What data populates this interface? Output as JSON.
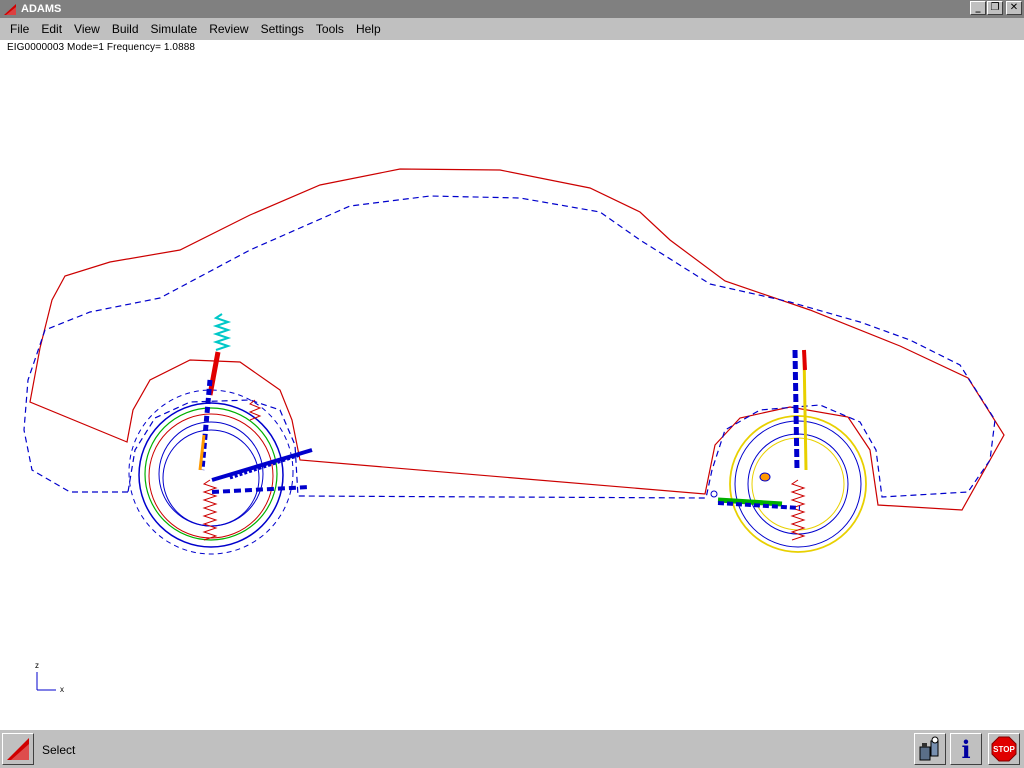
{
  "window": {
    "title": "ADAMS",
    "minimize": "_",
    "restore": "❐",
    "close": "✕"
  },
  "menu": [
    {
      "label": "File"
    },
    {
      "label": "Edit"
    },
    {
      "label": "View"
    },
    {
      "label": "Build"
    },
    {
      "label": "Simulate"
    },
    {
      "label": "Review"
    },
    {
      "label": "Settings"
    },
    {
      "label": "Tools"
    },
    {
      "label": "Help"
    }
  ],
  "viewport": {
    "info": "EIG0000003  Mode=1  Frequency= 1.0888",
    "triad": {
      "z_label": "z",
      "x_label": "x"
    }
  },
  "status": {
    "text": "Select",
    "tools": [
      {
        "name": "tools-palette-icon"
      },
      {
        "name": "info-icon",
        "label": "i"
      },
      {
        "name": "stop-icon",
        "label": "STOP"
      }
    ]
  },
  "colors": {
    "titlebar": "#808080",
    "chrome": "#c0c0c0",
    "body_outline": "#cc0000",
    "mode_shape": "#0000cc",
    "spring_front": "#00c8c8",
    "strut_red": "#e00000",
    "rear_tire": "#e8d000",
    "green_link": "#00b000",
    "orange": "#ff9900"
  }
}
